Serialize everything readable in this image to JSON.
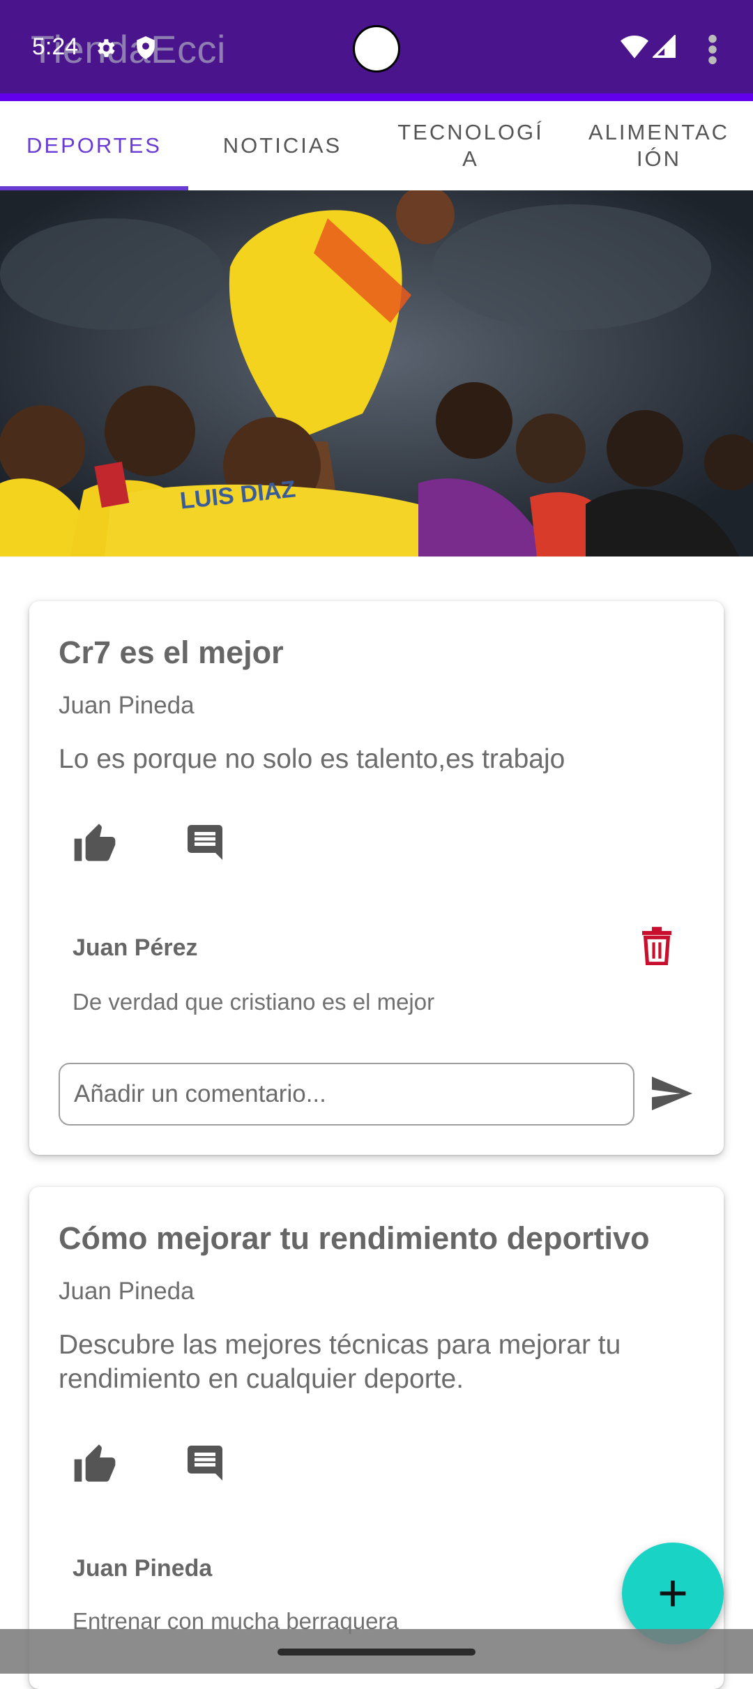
{
  "status_bar": {
    "time": "5:24"
  },
  "app_bar": {
    "title": "TiendaEcci"
  },
  "tabs": [
    {
      "label": "DEPORTES",
      "active": true
    },
    {
      "label": "NOTICIAS",
      "active": false
    },
    {
      "label": "TECNOLOGÍ\nA",
      "active": false
    },
    {
      "label": "ALIMENTAC\nIÓN",
      "active": false
    }
  ],
  "hero": {
    "jersey_text": "LUIS DIAZ"
  },
  "posts": [
    {
      "title": "Cr7 es el mejor",
      "author": "Juan Pineda",
      "body": "Lo es porque no solo es talento,es trabajo",
      "comment": {
        "author": "Juan Pérez",
        "text": "De verdad que cristiano es el mejor"
      },
      "input_placeholder": "Añadir un comentario..."
    },
    {
      "title": "Cómo mejorar tu rendimiento deportivo",
      "author": "Juan Pineda",
      "body": "Descubre las mejores técnicas para mejorar tu rendimiento en cualquier deporte.",
      "comment": {
        "author": "Juan Pineda",
        "text": "Entrenar con mucha berraquera"
      }
    }
  ],
  "icons": {
    "like": "thumb-up-icon",
    "comment": "comment-icon",
    "delete": "trash-icon",
    "send": "send-icon",
    "fab": "plus-icon"
  },
  "colors": {
    "app_bar": "#4a148c",
    "tab_active": "#6a3bd4",
    "delete": "#c8102e",
    "fab": "#19d3c5"
  }
}
